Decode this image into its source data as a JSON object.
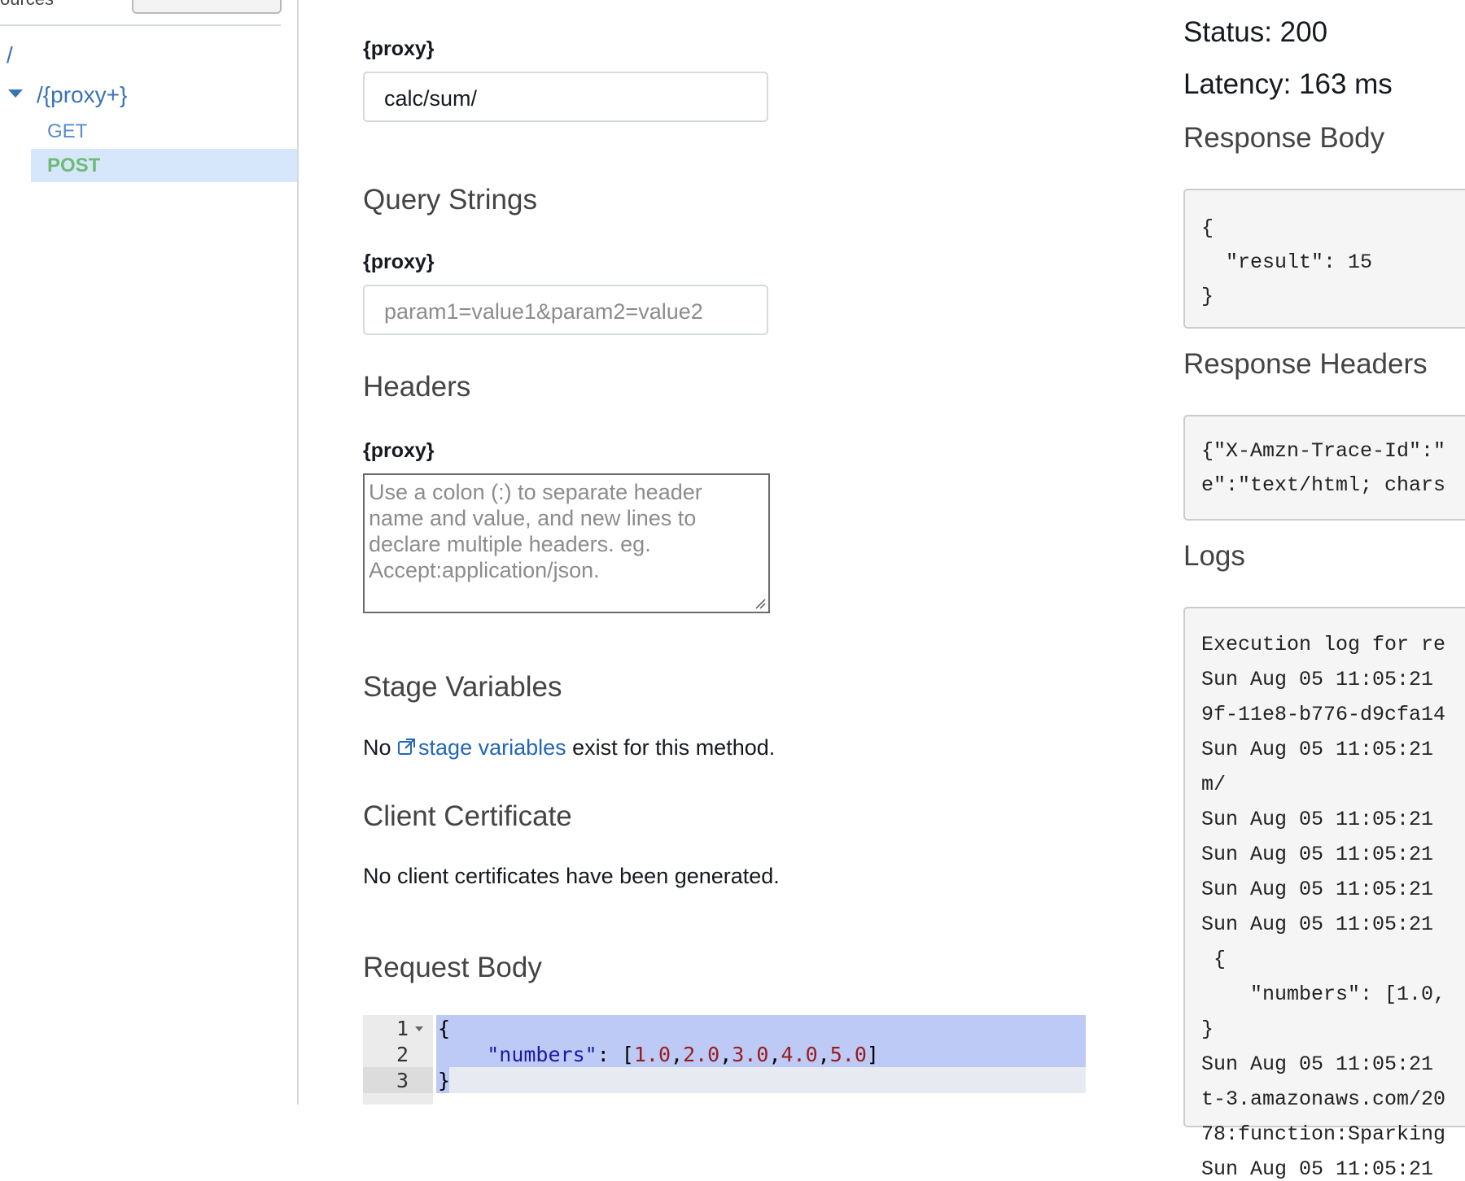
{
  "sidebar": {
    "top_label": "ources",
    "tree": {
      "root": "/",
      "proxy_resource": "/{proxy+}",
      "methods": [
        "GET",
        "POST"
      ]
    }
  },
  "request": {
    "path_param_label": "{proxy}",
    "path_value": "calc/sum/",
    "query_heading": "Query Strings",
    "query_label": "{proxy}",
    "query_placeholder": "param1=value1&param2=value2",
    "headers_heading": "Headers",
    "headers_label": "{proxy}",
    "headers_placeholder": "Use a colon (:) to separate header name and value, and new lines to declare multiple headers. eg. Accept:application/json.",
    "stage_heading": "Stage Variables",
    "stage_text_before": "No ",
    "stage_link": "stage variables",
    "stage_text_after": " exist for this method.",
    "cert_heading": "Client Certificate",
    "cert_text": "No client certificates have been generated.",
    "body_heading": "Request Body",
    "body_lines": {
      "line_numbers": [
        "1",
        "2",
        "3"
      ],
      "l1": "{",
      "l2_key": "\"numbers\"",
      "l2_sep": ": [",
      "numbers": [
        "1.0",
        "2.0",
        "3.0",
        "4.0",
        "5.0"
      ],
      "l2_close": "]",
      "l3": "}"
    }
  },
  "response": {
    "status": "Status: 200",
    "latency": "Latency: 163 ms",
    "body_heading": "Response Body",
    "body_lines": [
      "{",
      "  \"result\": 15",
      "}"
    ],
    "headers_heading": "Response Headers",
    "headers_lines": [
      "{\"X-Amzn-Trace-Id\":\"",
      "e\":\"text/html; chars"
    ],
    "logs_heading": "Logs",
    "log_lines": [
      "Execution log for re",
      "Sun Aug 05 11:05:21 ",
      "9f-11e8-b776-d9cfa14",
      "Sun Aug 05 11:05:21 ",
      "m/",
      "Sun Aug 05 11:05:21 ",
      "Sun Aug 05 11:05:21 ",
      "Sun Aug 05 11:05:21 ",
      "Sun Aug 05 11:05:21 ",
      " {",
      "    \"numbers\": [1.0,",
      "}",
      "Sun Aug 05 11:05:21 ",
      "t-3.amazonaws.com/20",
      "78:function:Sparking",
      "Sun Aug 05 11:05:21 "
    ]
  },
  "colors": {
    "link": "#2166b8",
    "method_get": "#5a8cc7",
    "method_post": "#6dbb75",
    "selected_bg": "#d7e7fb"
  },
  "icons": [
    "caret-down-icon",
    "external-link-icon",
    "fold-arrow-icon",
    "resize-grip-icon"
  ]
}
